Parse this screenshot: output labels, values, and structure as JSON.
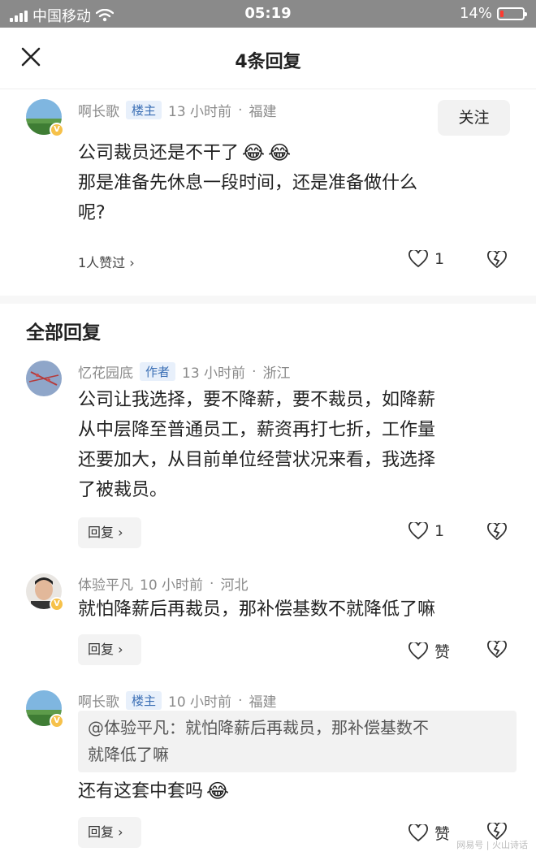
{
  "status": {
    "carrier": "中国移动",
    "time": "05:19",
    "battery": "14%"
  },
  "header": {
    "title": "4条回复",
    "close_icon": "close-icon"
  },
  "main_comment": {
    "user": "啊长歌",
    "tag": "楼主",
    "time": "13 小时前",
    "location": "福建",
    "follow_label": "关注",
    "line1": "公司裁员还是不干了",
    "line2": "那是准备先休息一段时间，还是准备做什么",
    "line3": "呢?",
    "likes_summary": "1人赞过",
    "like_count": "1"
  },
  "section_title": "全部回复",
  "replies": [
    {
      "user": "忆花园底",
      "tag": "作者",
      "time": "13 小时前",
      "location": "浙江",
      "lines": [
        "公司让我选择，要不降薪，要不裁员，如降薪",
        "从中层降至普通员工，薪资再打七折，工作量",
        "还要加大，从目前单位经营状况来看，我选择",
        "了被裁员。"
      ],
      "reply_label": "回复",
      "like_count": "1"
    },
    {
      "user": "体验平凡",
      "time": "10 小时前",
      "location": "河北",
      "text": "就怕降薪后再裁员，那补偿基数不就降低了嘛",
      "reply_label": "回复",
      "like_label": "赞"
    },
    {
      "user": "啊长歌",
      "tag": "楼主",
      "time": "10 小时前",
      "location": "福建",
      "quote_line1": "@体验平凡：就怕降薪后再裁员，那补偿基数不",
      "quote_line2": "就降低了嘛",
      "text": "还有这套中套吗",
      "reply_label": "回复",
      "like_label": "赞"
    }
  ],
  "watermark": "网易号 | 火山诗话",
  "colors": {
    "accent": "#3b6fb5",
    "meta": "#8a8a8a",
    "badge": "#f6c14a"
  }
}
